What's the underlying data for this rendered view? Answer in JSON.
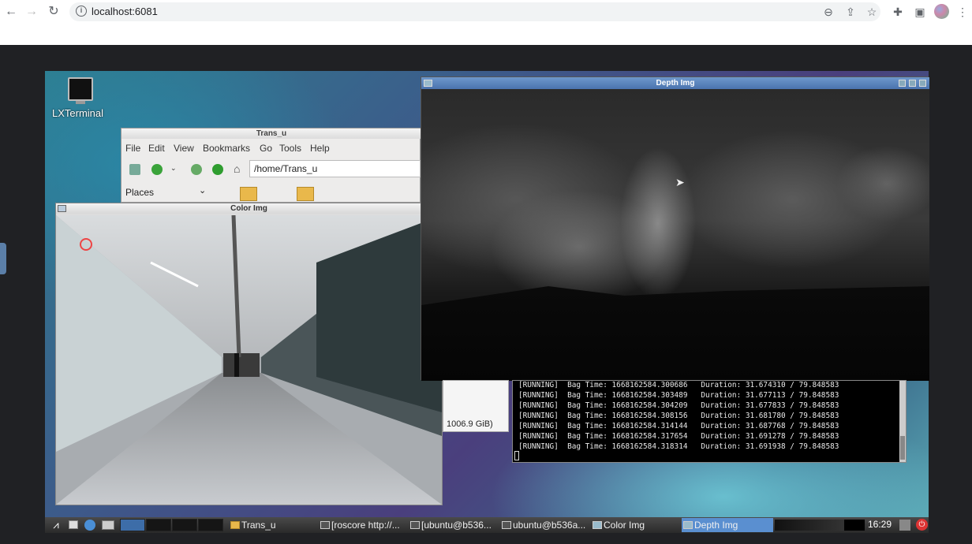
{
  "browser": {
    "url": "localhost:6081",
    "icons": [
      "back-icon",
      "forward-icon",
      "reload-icon",
      "info-icon",
      "zoom-icon",
      "share-icon",
      "star-icon",
      "extensions-icon",
      "sidepanel-icon",
      "profile-icon",
      "menu-icon"
    ]
  },
  "desktop": {
    "icon_label": "LXTerminal"
  },
  "file_manager": {
    "title": "Trans_u",
    "menu": [
      "File",
      "Edit",
      "View",
      "Bookmarks",
      "Go",
      "Tools",
      "Help"
    ],
    "path": "/home/Trans_u",
    "places_label": "Places"
  },
  "color_window": {
    "title": "Color Img"
  },
  "depth_window": {
    "title": "Depth Img"
  },
  "disk_label": "1006.9 GiB)",
  "terminal": {
    "lines": [
      "[RUNNING]  Bag Time: 1668162584.300686   Duration: 31.674310 / 79.848583",
      "[RUNNING]  Bag Time: 1668162584.303489   Duration: 31.677113 / 79.848583",
      "[RUNNING]  Bag Time: 1668162584.304209   Duration: 31.677833 / 79.848583",
      "[RUNNING]  Bag Time: 1668162584.308156   Duration: 31.681780 / 79.848583",
      "[RUNNING]  Bag Time: 1668162584.314144   Duration: 31.687768 / 79.848583",
      "[RUNNING]  Bag Time: 1668162584.317654   Duration: 31.691278 / 79.848583",
      "[RUNNING]  Bag Time: 1668162584.318314   Duration: 31.691938 / 79.848583"
    ]
  },
  "taskbar": {
    "items": [
      "Trans_u",
      "[roscore http://...",
      "[ubuntu@b536...",
      "ubuntu@b536a...",
      "Color Img",
      "Depth Img"
    ],
    "active_index": 5,
    "clock": "16:29"
  }
}
